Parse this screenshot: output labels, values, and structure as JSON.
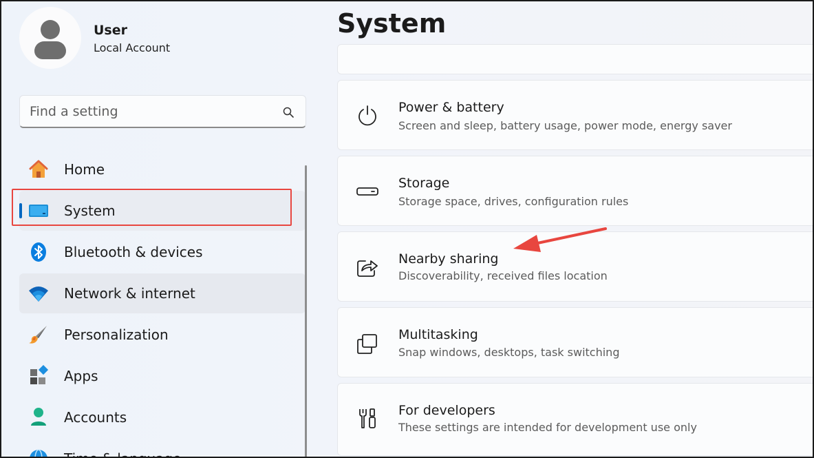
{
  "user": {
    "name": "User",
    "account_type": "Local Account"
  },
  "search": {
    "placeholder": "Find a setting"
  },
  "nav": {
    "items": [
      {
        "label": "Home"
      },
      {
        "label": "System"
      },
      {
        "label": "Bluetooth & devices"
      },
      {
        "label": "Network & internet"
      },
      {
        "label": "Personalization"
      },
      {
        "label": "Apps"
      },
      {
        "label": "Accounts"
      },
      {
        "label": "Time & language"
      }
    ]
  },
  "main": {
    "title": "System",
    "cards": [
      {
        "title": "Power & battery",
        "subtitle": "Screen and sleep, battery usage, power mode, energy saver"
      },
      {
        "title": "Storage",
        "subtitle": "Storage space, drives, configuration rules"
      },
      {
        "title": "Nearby sharing",
        "subtitle": "Discoverability, received files location"
      },
      {
        "title": "Multitasking",
        "subtitle": "Snap windows, desktops, task switching"
      },
      {
        "title": "For developers",
        "subtitle": "These settings are intended for development use only"
      }
    ]
  },
  "colors": {
    "accent": "#0067c0",
    "annotation": "#e8463f"
  }
}
